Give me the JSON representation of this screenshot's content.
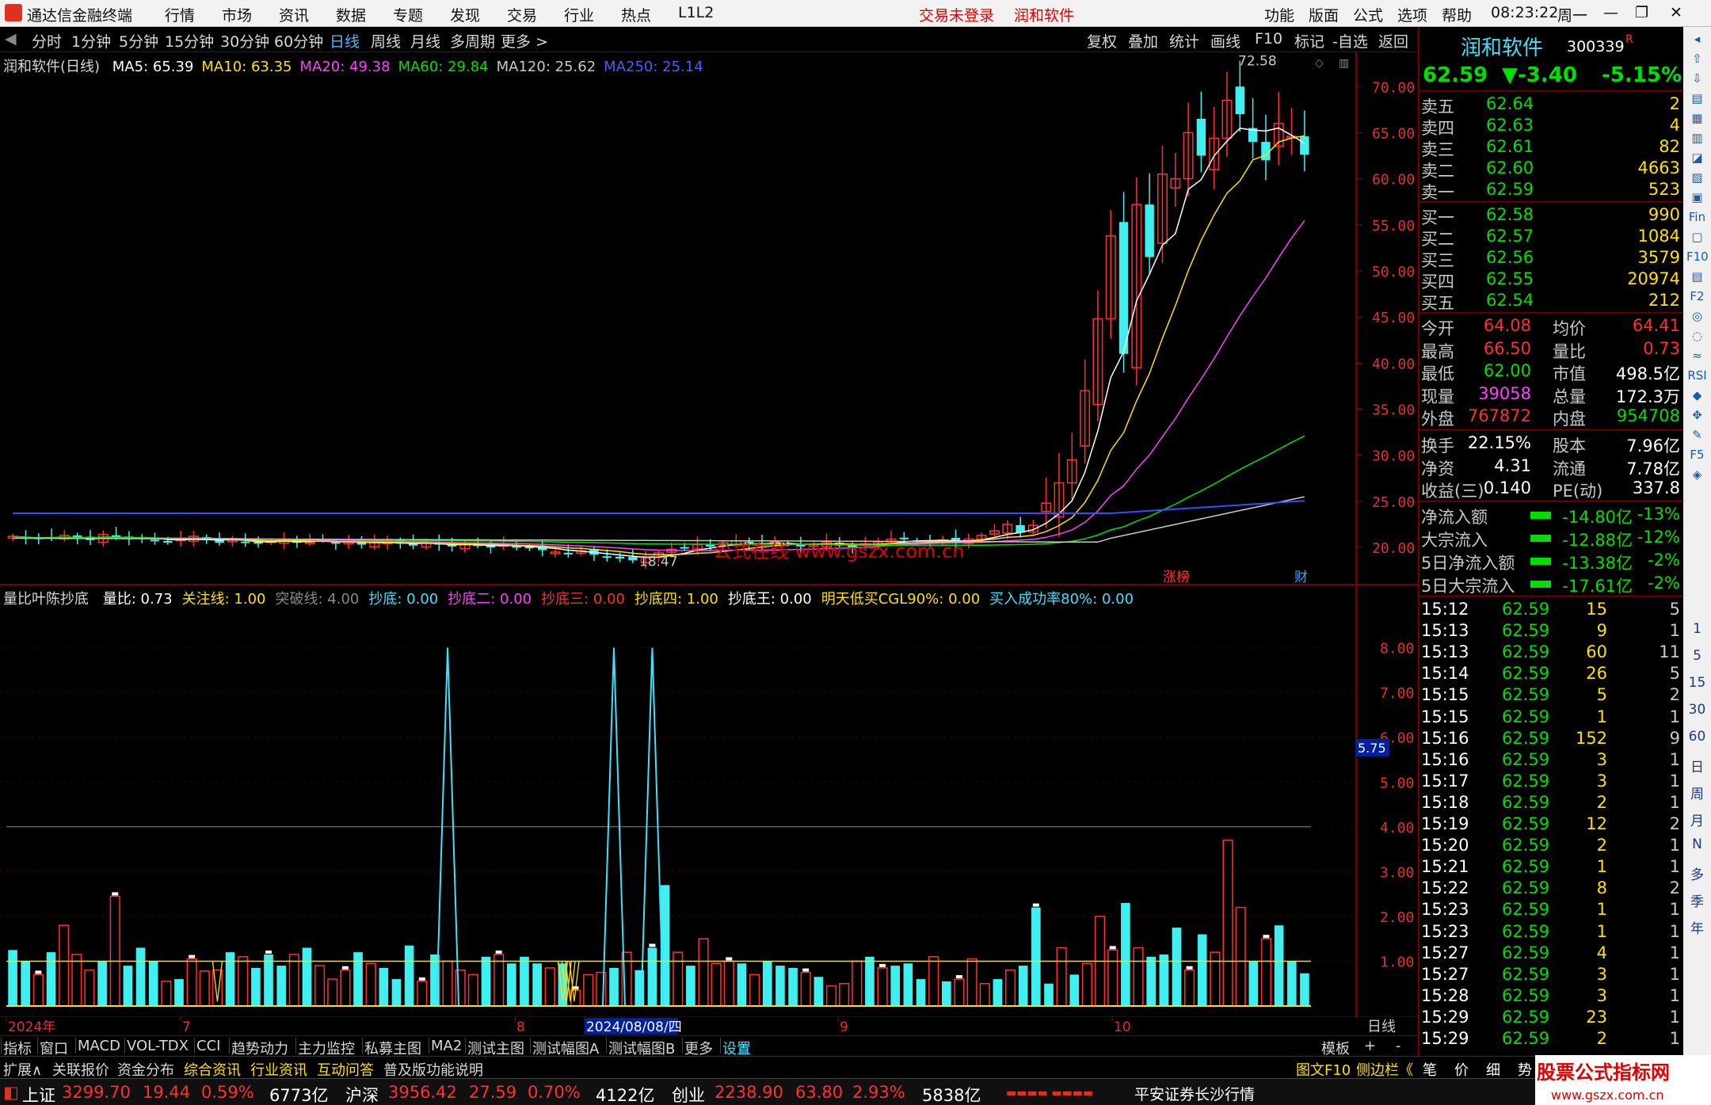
{
  "titlebar": {
    "app": "通达信金融终端",
    "menus": [
      "行情",
      "市场",
      "资讯",
      "数据",
      "专题",
      "发现",
      "交易",
      "行业",
      "热点",
      "L1L2"
    ],
    "notice": "交易未登录",
    "stock": "润和软件",
    "right_menus": [
      "功能",
      "版面",
      "公式",
      "选项",
      "帮助"
    ],
    "time": "08:23:22",
    "weekday": "周一"
  },
  "periodbar": {
    "items": [
      "分时",
      "1分钟",
      "5分钟",
      "15分钟",
      "30分钟",
      "60分钟",
      "日线",
      "周线",
      "月线",
      "多周期",
      "更多 >"
    ],
    "selected": "日线",
    "tools": [
      "复权",
      "叠加",
      "统计",
      "画线",
      "F10",
      "标记",
      "-自选",
      "返回"
    ]
  },
  "main": {
    "stock_label": "润和软件(日线)",
    "ma": [
      {
        "name": "MA5",
        "value": "65.39",
        "color": "#ffffff"
      },
      {
        "name": "MA10",
        "value": "63.35",
        "color": "#ffe000"
      },
      {
        "name": "MA20",
        "value": "49.38",
        "color": "#ff40ff"
      },
      {
        "name": "MA60",
        "value": "29.84",
        "color": "#00e000"
      },
      {
        "name": "MA120",
        "value": "25.62",
        "color": "#c8c8c8"
      },
      {
        "name": "MA250",
        "value": "25.14",
        "color": "#4060ff"
      }
    ],
    "high_label": "72.58",
    "low_label": "18.47",
    "watermark": "公式在线 www.gszx.com.cn",
    "badges": [
      "涨榜",
      "财"
    ],
    "y_ticks": [
      "70.00",
      "65.00",
      "60.00",
      "55.00",
      "50.00",
      "45.00",
      "40.00",
      "35.00",
      "30.00",
      "25.00",
      "20.00"
    ]
  },
  "indicator": {
    "name": "量比叶陈抄底",
    "values": [
      {
        "label": "量比:",
        "value": "0.73",
        "color": "#ffffff"
      },
      {
        "label": "关注线:",
        "value": "1.00",
        "color": "#ffe000"
      },
      {
        "label": "突破线:",
        "value": "4.00",
        "color": "#888888"
      },
      {
        "label": "抄底:",
        "value": "0.00",
        "color": "#40e0ff"
      },
      {
        "label": "抄底二:",
        "value": "0.00",
        "color": "#ff40ff"
      },
      {
        "label": "抄底三:",
        "value": "0.00",
        "color": "#ff3030"
      },
      {
        "label": "抄底四:",
        "value": "1.00",
        "color": "#ffe000"
      },
      {
        "label": "抄底王:",
        "value": "0.00",
        "color": "#ffffff"
      },
      {
        "label": "明天低买CGL90%:",
        "value": "0.00",
        "color": "#ffe000"
      },
      {
        "label": "买入成功率80%:",
        "value": "0.00",
        "color": "#40e0ff"
      }
    ],
    "y_ticks": [
      "8.00",
      "7.00",
      "6.00",
      "5.00",
      "4.00",
      "3.00",
      "2.00",
      "1.00"
    ],
    "current": "5.75"
  },
  "xaxis": {
    "labels": [
      "2024年",
      "7",
      "8",
      "2024/08/08/四",
      "9",
      "10"
    ],
    "period": "日线"
  },
  "tabbar": [
    "指标",
    "窗口",
    "MACD",
    "VOL-TDX",
    "CCI",
    "趋势动力",
    "主力监控",
    "私募主图",
    "MA2",
    "测试主图",
    "测试幅图A",
    "测试幅图B",
    "更多",
    "设置"
  ],
  "tabbar_right": [
    "模板",
    "+",
    "-"
  ],
  "tabbar2": [
    "扩展∧",
    "关联报价",
    "资金分布",
    "综合资讯",
    "行业资讯",
    "互动问答",
    "普及版功能说明"
  ],
  "tabbar2_right": [
    "图文F10",
    "侧边栏《",
    "笔",
    "价",
    "细",
    "势"
  ],
  "status": {
    "sh": {
      "name": "上证",
      "price": "3299.70",
      "chg": "19.44",
      "pct": "0.59%",
      "amt": "6773亿"
    },
    "hs": {
      "name": "沪深",
      "price": "3956.42",
      "chg": "27.59",
      "pct": "0.70%",
      "amt": "4122亿"
    },
    "cy": {
      "name": "创业",
      "price": "2238.90",
      "chg": "63.80",
      "pct": "2.93%",
      "amt": "5838亿"
    },
    "broker": "平安证券长沙行情",
    "site": "股票公式指标网",
    "url": "www.gszx.com.cn"
  },
  "quote": {
    "name": "润和软件",
    "code": "300339",
    "flag": "R",
    "price": "62.59",
    "chg": "▼-3.40",
    "pct": "-5.15%",
    "sell": [
      {
        "label": "卖五",
        "price": "62.64",
        "vol": "2"
      },
      {
        "label": "卖四",
        "price": "62.63",
        "vol": "4"
      },
      {
        "label": "卖三",
        "price": "62.61",
        "vol": "82"
      },
      {
        "label": "卖二",
        "price": "62.60",
        "vol": "4663"
      },
      {
        "label": "卖一",
        "price": "62.59",
        "vol": "523"
      }
    ],
    "buy": [
      {
        "label": "买一",
        "price": "62.58",
        "vol": "990"
      },
      {
        "label": "买二",
        "price": "62.57",
        "vol": "1084"
      },
      {
        "label": "买三",
        "price": "62.56",
        "vol": "3579"
      },
      {
        "label": "买四",
        "price": "62.55",
        "vol": "20974"
      },
      {
        "label": "买五",
        "price": "62.54",
        "vol": "212"
      }
    ],
    "stats": [
      [
        "今开",
        "64.08",
        "均价",
        "64.41"
      ],
      [
        "最高",
        "66.50",
        "量比",
        "0.73"
      ],
      [
        "最低",
        "62.00",
        "市值",
        "498.5亿"
      ],
      [
        "现量",
        "39058",
        "总量",
        "172.3万"
      ],
      [
        "外盘",
        "767872",
        "内盘",
        "954708"
      ]
    ],
    "stats2": [
      [
        "换手",
        "22.15%",
        "股本",
        "7.96亿"
      ],
      [
        "净资",
        "4.31",
        "流通",
        "7.78亿"
      ],
      [
        "收益(三)",
        "0.140",
        "PE(动)",
        "337.8"
      ]
    ],
    "flows": [
      {
        "label": "净流入额",
        "value": "-14.80亿",
        "pct": "-13%"
      },
      {
        "label": "大宗流入",
        "value": "-12.88亿",
        "pct": "-12%"
      },
      {
        "label": "5日净流入额",
        "value": "-13.38亿",
        "pct": "-2%"
      },
      {
        "label": "5日大宗流入",
        "value": "-17.61亿",
        "pct": "-2%"
      }
    ],
    "ticks": [
      [
        "15:12",
        "62.59",
        "15",
        "5"
      ],
      [
        "15:13",
        "62.59",
        "9",
        "1"
      ],
      [
        "15:13",
        "62.59",
        "60",
        "11"
      ],
      [
        "15:14",
        "62.59",
        "26",
        "5"
      ],
      [
        "15:15",
        "62.59",
        "5",
        "2"
      ],
      [
        "15:15",
        "62.59",
        "1",
        "1"
      ],
      [
        "15:16",
        "62.59",
        "152",
        "9"
      ],
      [
        "15:16",
        "62.59",
        "3",
        "1"
      ],
      [
        "15:17",
        "62.59",
        "3",
        "1"
      ],
      [
        "15:18",
        "62.59",
        "2",
        "1"
      ],
      [
        "15:19",
        "62.59",
        "12",
        "2"
      ],
      [
        "15:20",
        "62.59",
        "2",
        "1"
      ],
      [
        "15:21",
        "62.59",
        "1",
        "1"
      ],
      [
        "15:22",
        "62.59",
        "8",
        "2"
      ],
      [
        "15:23",
        "62.59",
        "1",
        "1"
      ],
      [
        "15:23",
        "62.59",
        "1",
        "1"
      ],
      [
        "15:27",
        "62.59",
        "4",
        "1"
      ],
      [
        "15:27",
        "62.59",
        "3",
        "1"
      ],
      [
        "15:28",
        "62.59",
        "3",
        "1"
      ],
      [
        "15:29",
        "62.59",
        "23",
        "1"
      ],
      [
        "15:29",
        "62.59",
        "2",
        "1"
      ]
    ]
  },
  "sidebar_icons": [
    "1",
    "5",
    "15",
    "30",
    "60",
    "日",
    "周",
    "月",
    "N",
    "多",
    "季",
    "年"
  ],
  "chart_data": {
    "type": "candlestick",
    "x": "trading days 2024 (Jun–Oct)",
    "ylim": [
      17,
      72
    ],
    "closes": [
      21.2,
      21.0,
      20.9,
      21.1,
      21.3,
      21.0,
      20.8,
      21.4,
      21.1,
      20.9,
      21.0,
      20.7,
      20.6,
      20.9,
      21.2,
      20.8,
      20.5,
      20.8,
      20.6,
      20.4,
      20.7,
      20.9,
      20.5,
      20.6,
      20.8,
      20.4,
      20.6,
      20.3,
      20.5,
      20.7,
      20.4,
      20.2,
      20.5,
      20.3,
      20.1,
      20.4,
      20.2,
      20.0,
      20.3,
      20.1,
      19.9,
      19.7,
      19.5,
      19.3,
      19.6,
      19.2,
      19.0,
      18.8,
      18.6,
      19.0,
      19.4,
      19.8,
      20.0,
      20.3,
      20.1,
      20.5,
      20.7,
      20.4,
      20.2,
      20.6,
      20.4,
      20.1,
      20.3,
      20.6,
      20.2,
      20.0,
      20.4,
      20.6,
      20.9,
      21.0,
      20.7,
      20.5,
      20.8,
      20.6,
      20.9,
      21.3,
      21.8,
      22.5,
      21.6,
      22.4,
      24.8,
      27.0,
      29.5,
      37.0,
      44.8,
      53.8,
      41.0,
      57.2,
      51.5,
      60.5,
      60.0,
      65.0,
      62.5,
      64.4,
      68.5,
      67.0,
      64.0,
      62.0,
      66.0,
      64.6,
      62.6
    ],
    "volume": [
      1.25,
      1.0,
      0.7,
      1.2,
      1.8,
      1.15,
      0.8,
      1.0,
      2.45,
      0.9,
      1.3,
      1.0,
      0.55,
      0.6,
      1.05,
      0.78,
      0.8,
      1.2,
      1.1,
      0.85,
      1.15,
      0.9,
      1.15,
      1.3,
      0.9,
      0.6,
      0.8,
      1.2,
      0.95,
      0.85,
      0.6,
      1.35,
      0.55,
      1.15,
      1.0,
      0.8,
      0.7,
      1.1,
      1.15,
      0.95,
      1.1,
      0.95,
      0.85,
      0.95,
      0.35,
      0.7,
      0.75,
      0.85,
      1.2,
      0.8,
      1.3,
      2.7,
      1.2,
      0.9,
      1.5,
      0.95,
      1.0,
      0.95,
      0.7,
      1.0,
      0.9,
      0.85,
      0.75,
      0.65,
      0.45,
      0.5,
      1.0,
      1.1,
      0.85,
      0.9,
      0.95,
      0.6,
      1.1,
      0.55,
      0.6,
      1.05,
      0.5,
      0.6,
      0.8,
      0.9,
      2.2,
      0.5,
      1.3,
      0.7,
      0.95,
      2.0,
      1.25,
      2.3,
      1.3,
      1.1,
      1.15,
      1.75,
      0.8,
      1.6,
      1.2,
      3.7,
      2.2,
      1.0,
      1.5,
      1.8,
      1.0,
      0.73
    ]
  }
}
